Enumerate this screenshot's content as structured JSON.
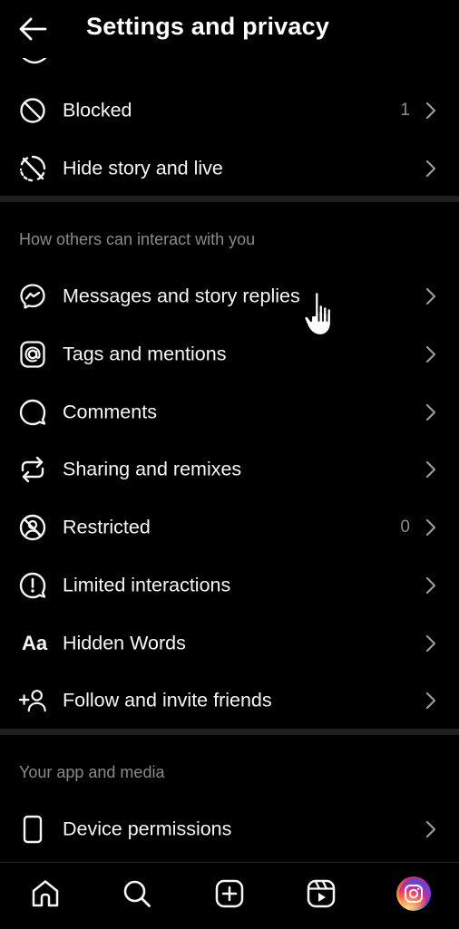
{
  "header": {
    "title": "Settings and privacy"
  },
  "rows_top": [
    {
      "label": "Blocked",
      "count": "1",
      "icon": "blocked-icon"
    },
    {
      "label": "Hide story and live",
      "count": "",
      "icon": "hide-story-icon"
    }
  ],
  "section_interact": {
    "title": "How others can interact with you",
    "items": [
      {
        "label": "Messages and story replies",
        "count": "",
        "icon": "messenger-icon"
      },
      {
        "label": "Tags and mentions",
        "count": "",
        "icon": "at-sign-icon"
      },
      {
        "label": "Comments",
        "count": "",
        "icon": "comment-bubble-icon"
      },
      {
        "label": "Sharing and remixes",
        "count": "",
        "icon": "share-remix-icon"
      },
      {
        "label": "Restricted",
        "count": "0",
        "icon": "restricted-icon"
      },
      {
        "label": "Limited interactions",
        "count": "",
        "icon": "limited-interactions-icon"
      },
      {
        "label": "Hidden Words",
        "count": "",
        "icon": "hidden-words-icon",
        "glyph": "Aa"
      },
      {
        "label": "Follow and invite friends",
        "count": "",
        "icon": "add-person-icon"
      }
    ]
  },
  "section_app": {
    "title": "Your app and media",
    "items": [
      {
        "label": "Device permissions",
        "count": "",
        "icon": "phone-device-icon"
      }
    ]
  },
  "bottom_nav": [
    {
      "name": "home",
      "icon": "home-icon"
    },
    {
      "name": "search",
      "icon": "search-icon"
    },
    {
      "name": "create",
      "icon": "plus-square-icon"
    },
    {
      "name": "reels",
      "icon": "reels-icon"
    },
    {
      "name": "profile",
      "icon": "avatar"
    }
  ],
  "colors": {
    "background": "#000000",
    "text": "#f5f5f5",
    "muted": "#8e8e8e",
    "divider": "#1f1f1f"
  }
}
